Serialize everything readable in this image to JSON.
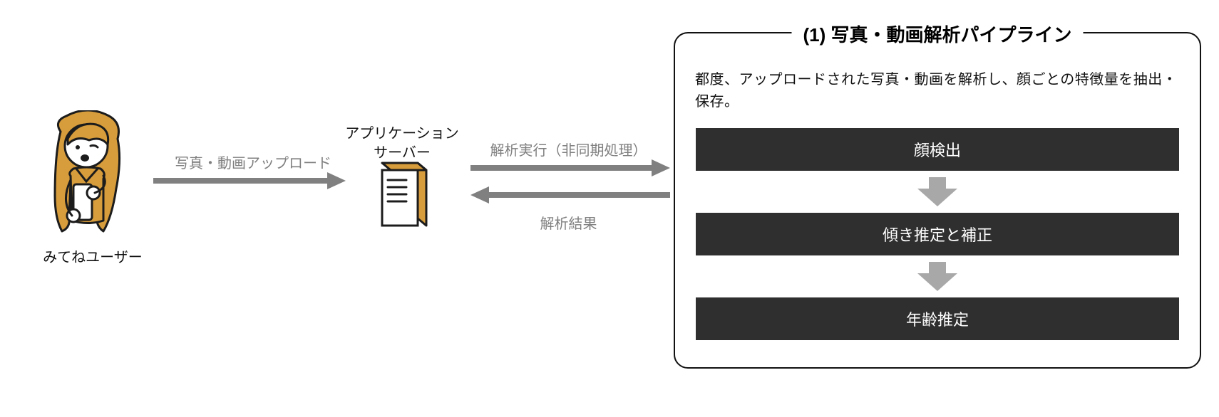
{
  "user": {
    "label": "みてねユーザー"
  },
  "arrows": {
    "upload_label": "写真・動画アップロード",
    "exec_label": "解析実行（非同期処理）",
    "result_label": "解析結果"
  },
  "server": {
    "label": "アプリケーション\nサーバー"
  },
  "pipeline": {
    "title": "(1) 写真・動画解析パイプライン",
    "description": "都度、アップロードされた写真・動画を解析し、顔ごとの特徴量を抽出・保存。",
    "steps": [
      "顔検出",
      "傾き推定と補正",
      "年齢推定"
    ]
  }
}
